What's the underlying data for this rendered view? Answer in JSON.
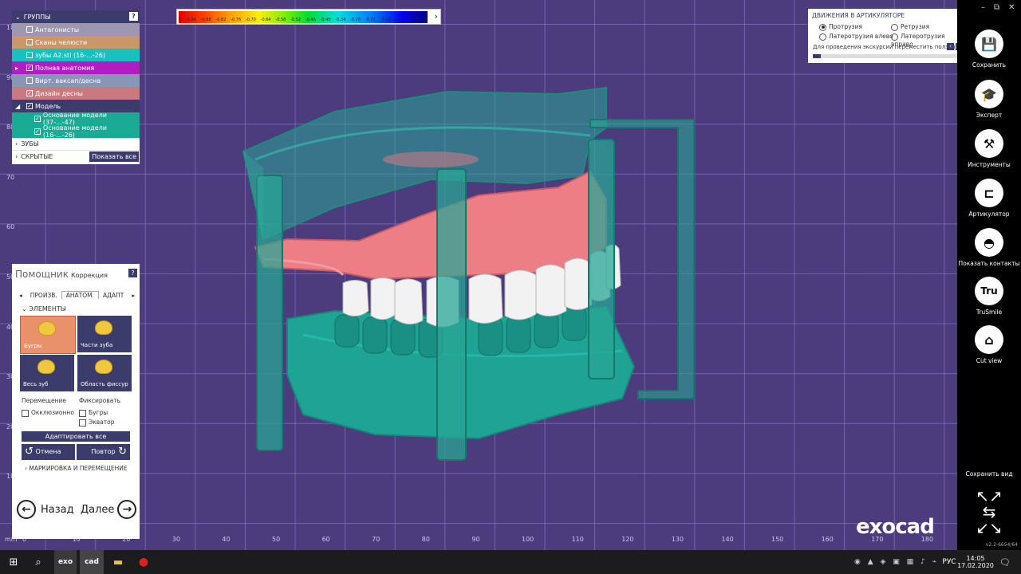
{
  "color_scale": {
    "ticks": [
      "1",
      "-0.94",
      "-0.88",
      "-0.82",
      "-0.76",
      "-0.70",
      "-0.64",
      "-0.58",
      "-0.52",
      "-0.46",
      "-0.40",
      "-0.34",
      "-0.28",
      "-0.22",
      "-0.18",
      "-0.12",
      "-0.06",
      "0"
    ],
    "expand_icon": "chevron-right-icon"
  },
  "groups": {
    "header": "ГРУППЫ",
    "help": "?",
    "items": [
      {
        "label": "Антагонисты",
        "checked": false,
        "color": "#9e97ad"
      },
      {
        "label": "Сканы челюсти",
        "checked": false,
        "color": "#c8986a"
      },
      {
        "label": "зубы A2.stl (16-...-26)",
        "checked": false,
        "color": "#19c0c0"
      },
      {
        "label": "Полная анатомия",
        "checked": true,
        "color": "#b01ec0"
      },
      {
        "label": "Вирт. ваксап/десна",
        "checked": false,
        "color": "#8a96b6"
      },
      {
        "label": "Дизайн десны",
        "checked": true,
        "color": "#c97a80"
      },
      {
        "label": "Модель",
        "checked": true,
        "color": "#3c3c6c"
      },
      {
        "label": "Основание модели (37-...-47)",
        "checked": true,
        "color": "#1aab95"
      },
      {
        "label": "Основание модели (16-...-26)",
        "checked": true,
        "color": "#1aab95"
      }
    ],
    "teeth": "ЗУБЫ",
    "hidden": "СКРЫТЫЕ",
    "show_all": "Показать все"
  },
  "helper": {
    "title": "Помощник",
    "subtitle": "Коррекция",
    "help": "?",
    "tabs": [
      "ПРОИЗВ.",
      "АНАТОМ.",
      "АДАПТ"
    ],
    "section": "ЭЛЕМЕНТЫ",
    "tiles": [
      "Бугры",
      "Части зуба",
      "Весь зуб",
      "Область фиссур"
    ],
    "move_label": "Перемещение",
    "fix_label": "Фиксировать",
    "occlusal": "Окклюзионно",
    "cusps": "Бугры",
    "equator": "Экватор",
    "adapt_all": "Адаптировать все",
    "undo": "Отмена",
    "redo": "Повтор",
    "marking": "МАРКИРОВКА И ПЕРЕМЕЩЕНИЕ",
    "back": "Назад",
    "next": "Далее"
  },
  "articulator": {
    "title": "ДВИЖЕНИЯ В АРТИКУЛЯТОРЕ",
    "protrusion": "Протрузия",
    "retrusion": "Ретрузия",
    "lat_left": "Латеротрузия влево",
    "lat_right": "Латеротрузия вправо",
    "hint": "Для проведения экскурсии переместить ползунок"
  },
  "toolbar": {
    "save": "Сохранить",
    "expert": "Эксперт",
    "tools": "Инструменты",
    "articulator": "Артикулятор",
    "contacts": "Показать контакты",
    "trusmile": "TruSmile",
    "trusmile_logo": "Tru",
    "cutview": "Cut view",
    "save_view": "Сохранить вид",
    "version": "v2.2-6654/64"
  },
  "ruler_x": [
    "mm",
    "0",
    "10",
    "20",
    "30",
    "40",
    "50",
    "60",
    "70",
    "80",
    "90",
    "100",
    "110",
    "120",
    "130",
    "140",
    "150",
    "160",
    "170",
    "180"
  ],
  "ruler_y": [
    "10",
    "20",
    "30",
    "40",
    "50",
    "60",
    "70",
    "80",
    "90",
    "100"
  ],
  "brand": "exocad",
  "taskbar": {
    "apps": [
      "exo",
      "cad"
    ],
    "lang": "РУС",
    "time": "14:05",
    "date": "17.02.2020"
  }
}
